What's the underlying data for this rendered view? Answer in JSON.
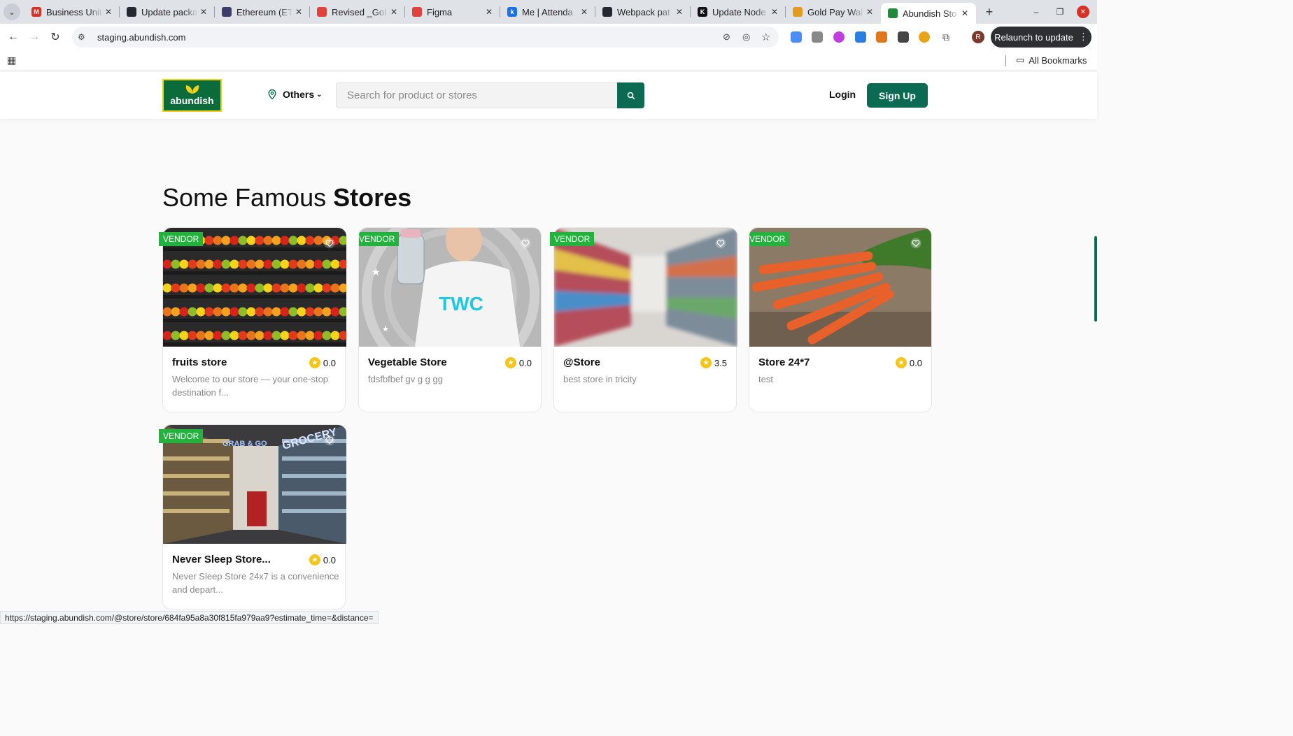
{
  "browser": {
    "tabs": [
      {
        "title": "Business Unit",
        "fav_color": "#d93025",
        "fav_glyph": "M"
      },
      {
        "title": "Update packa",
        "fav_color": "#24292f",
        "fav_glyph": ""
      },
      {
        "title": "Ethereum (ET",
        "fav_color": "#3c3c6a",
        "fav_glyph": ""
      },
      {
        "title": "Revised _Gol",
        "fav_color": "#e0433b",
        "fav_glyph": ""
      },
      {
        "title": "Figma",
        "fav_color": "#e0433b",
        "fav_glyph": ""
      },
      {
        "title": "Me | Attenda",
        "fav_color": "#1a73e8",
        "fav_glyph": "k"
      },
      {
        "title": "Webpack pat",
        "fav_color": "#24292f",
        "fav_glyph": ""
      },
      {
        "title": "Update Node",
        "fav_color": "#111111",
        "fav_glyph": "K"
      },
      {
        "title": "Gold Pay Wal",
        "fav_color": "#e39b1f",
        "fav_glyph": ""
      },
      {
        "title": "Abundish Sto",
        "fav_color": "#1f8a3a",
        "fav_glyph": ""
      }
    ],
    "url": "staging.abundish.com",
    "relaunch_label": "Relaunch to update",
    "bookmarks_label": "All Bookmarks",
    "profile_initial": "R",
    "status_url": "https://staging.abundish.com/@store/store/684fa95a8a30f815fa979aa9?estimate_time=&distance="
  },
  "header": {
    "logo_text": "abundish",
    "location_label": "Others",
    "search_placeholder": "Search for product or stores",
    "login_label": "Login",
    "signup_label": "Sign Up",
    "brand_color": "#0a6b52"
  },
  "section": {
    "title_light": "Some Famous ",
    "title_bold": "Stores"
  },
  "stores": [
    {
      "badge": "VENDOR",
      "name": "fruits store",
      "rating": "0.0",
      "desc": "Welcome to our store — your one-stop destination f..."
    },
    {
      "badge": "VENDOR",
      "name": "Vegetable Store",
      "rating": "0.0",
      "desc": "fdsfbfbef gv g g gg",
      "img_text": "TWC"
    },
    {
      "badge": "VENDOR",
      "name": "@Store",
      "rating": "3.5",
      "desc": "best store in tricity"
    },
    {
      "badge": "VENDOR",
      "name": "Store 24*7",
      "rating": "0.0",
      "desc": "test"
    },
    {
      "badge": "VENDOR",
      "name": "Never Sleep Store...",
      "rating": "0.0",
      "desc": "Never Sleep Store 24x7 is a convenience and depart...",
      "img_text_1": "GRAB & GO",
      "img_text_2": "GROCERY"
    }
  ]
}
